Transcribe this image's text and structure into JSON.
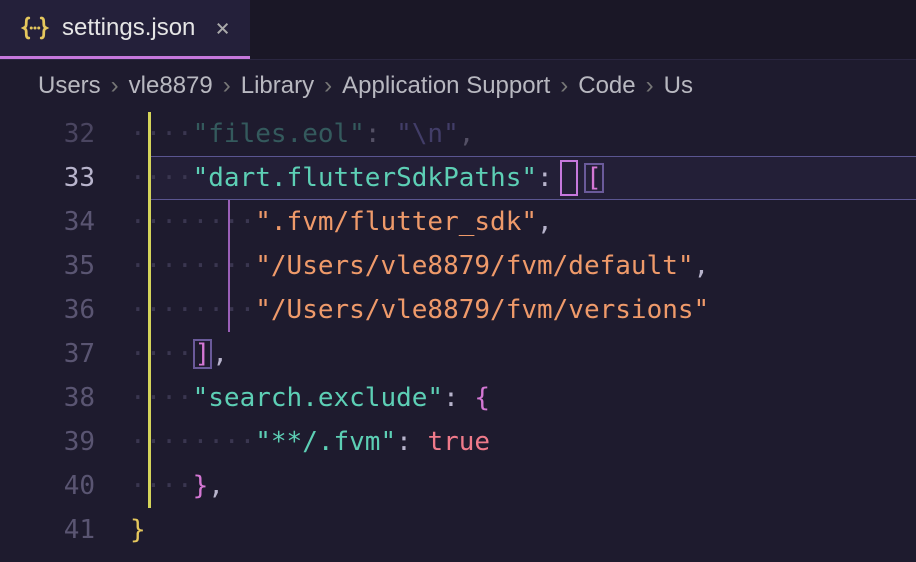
{
  "tab": {
    "filename": "settings.json"
  },
  "breadcrumbs": [
    "Users",
    "vle8879",
    "Library",
    "Application Support",
    "Code",
    "Us"
  ],
  "lines": {
    "l32": {
      "num": "32",
      "dimkey": "\"files.eol\"",
      "dimval": "\"\\n\""
    },
    "l33": {
      "num": "33",
      "key": "\"dart.flutterSdkPaths\"",
      "colon": ":",
      "open": "["
    },
    "l34": {
      "num": "34",
      "str": "\".fvm/flutter_sdk\"",
      "comma": ","
    },
    "l35": {
      "num": "35",
      "str": "\"/Users/vle8879/fvm/default\"",
      "comma": ","
    },
    "l36": {
      "num": "36",
      "str": "\"/Users/vle8879/fvm/versions\""
    },
    "l37": {
      "num": "37",
      "close": "]",
      "comma": ","
    },
    "l38": {
      "num": "38",
      "key": "\"search.exclude\"",
      "colon": ":",
      "open": "{"
    },
    "l39": {
      "num": "39",
      "key": "\"**/.fvm\"",
      "colon": ":",
      "val": "true"
    },
    "l40": {
      "num": "40",
      "close": "}",
      "comma": ","
    },
    "l41": {
      "num": "41",
      "close": "}"
    }
  }
}
